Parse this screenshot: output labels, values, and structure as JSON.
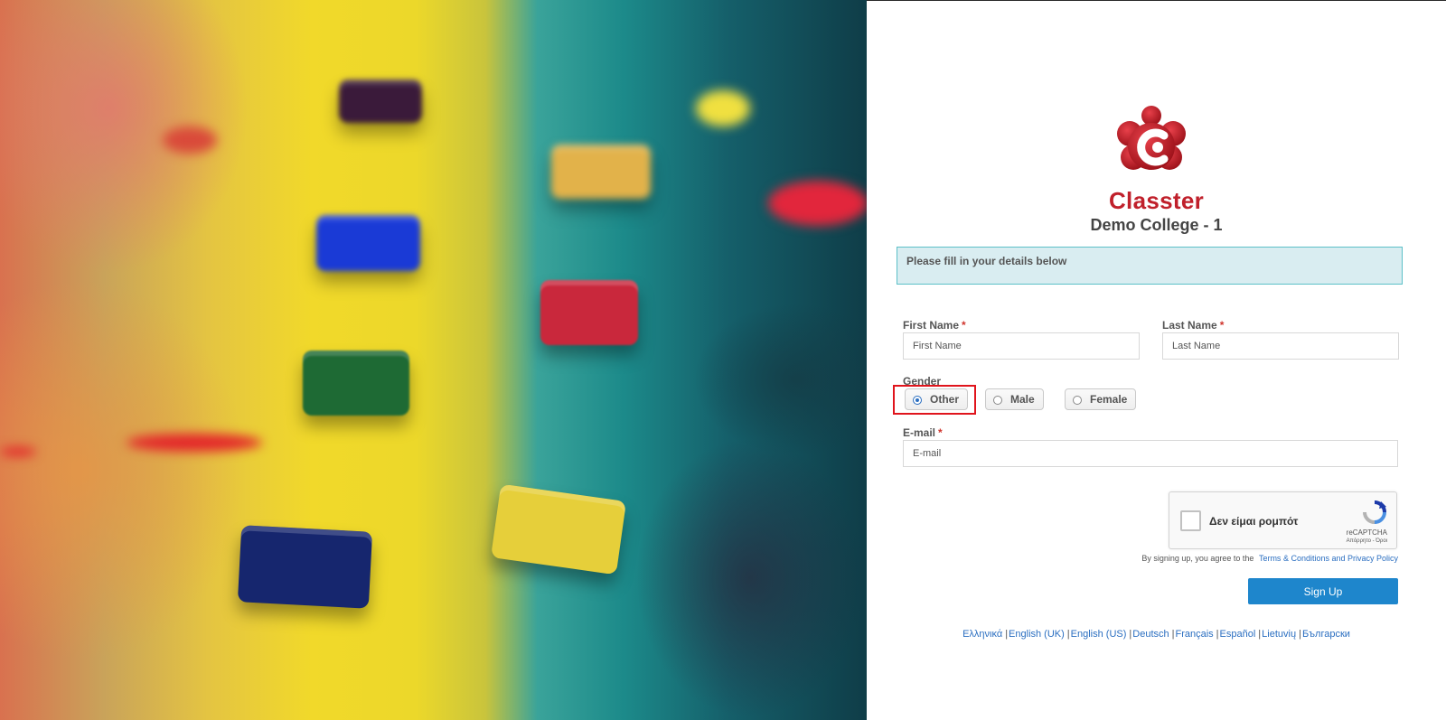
{
  "brand": {
    "name": "Classter",
    "subtitle": "Demo College - 1"
  },
  "notice": "Please fill in your details below",
  "form": {
    "first_name": {
      "label": "First Name",
      "required": "*",
      "placeholder": "First Name"
    },
    "last_name": {
      "label": "Last Name",
      "required": "*",
      "placeholder": "Last Name"
    },
    "gender": {
      "label": "Gender",
      "options": [
        {
          "label": "Other",
          "selected": true
        },
        {
          "label": "Male",
          "selected": false
        },
        {
          "label": "Female",
          "selected": false
        }
      ]
    },
    "email": {
      "label": "E-mail",
      "required": "*",
      "placeholder": "E-mail"
    }
  },
  "captcha": {
    "checkbox_text": "Δεν είμαι ρομπότ",
    "brand": "reCAPTCHA",
    "links": "Απόρρητο - Όροι"
  },
  "terms": {
    "prefix": "By signing up, you agree to the",
    "link": "Terms & Conditions and Privacy Policy"
  },
  "signup_button": "Sign Up",
  "languages": [
    "Ελληνικά",
    "English (UK)",
    "English (US)",
    "Deutsch",
    "Français",
    "Español",
    "Lietuvių",
    "Български"
  ],
  "colors": {
    "brand_red": "#c0202b",
    "primary_blue": "#1e86cc",
    "notice_bg": "#d9edf1",
    "highlight": "#e0141c"
  }
}
